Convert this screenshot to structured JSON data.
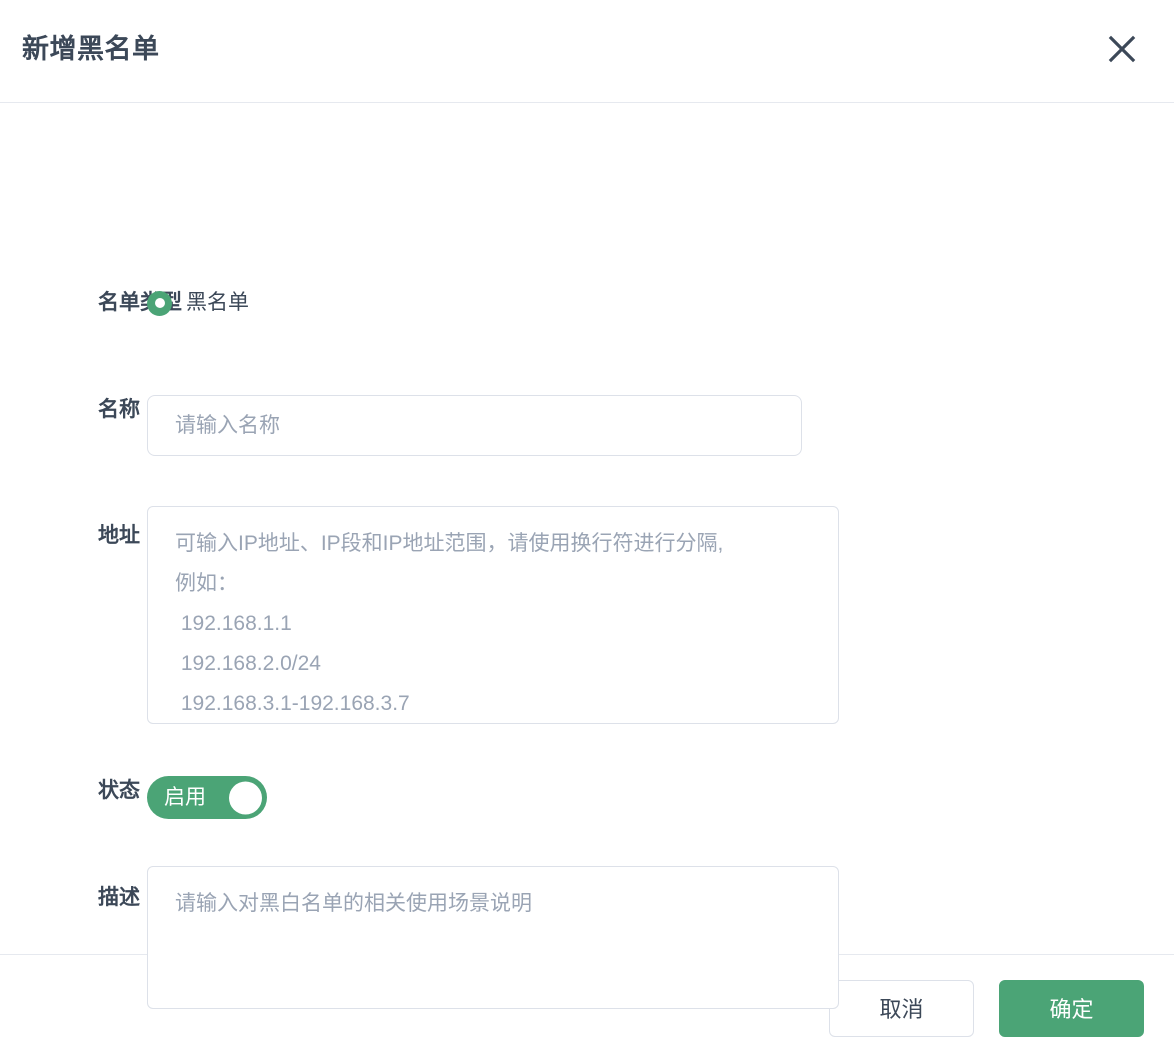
{
  "dialog": {
    "title": "新增黑名单",
    "close_icon": "close-icon"
  },
  "form": {
    "list_type": {
      "label": "名单类型",
      "selected": "黑名单",
      "options": [
        "黑名单"
      ]
    },
    "name": {
      "label": "名称",
      "value": "",
      "placeholder": "请输入名称"
    },
    "address": {
      "label": "地址",
      "value": "",
      "placeholder": "可输入IP地址、IP段和IP地址范围，请使用换行符进行分隔,\n例如：\n 192.168.1.1\n 192.168.2.0/24\n 192.168.3.1-192.168.3.7"
    },
    "status": {
      "label": "状态",
      "toggle_text": "启用",
      "enabled": true
    },
    "description": {
      "label": "描述",
      "value": "",
      "placeholder": "请输入对黑白名单的相关使用场景说明"
    }
  },
  "footer": {
    "cancel_label": "取消",
    "confirm_label": "确定"
  },
  "colors": {
    "accent_green": "#4ba476",
    "label_text": "#3c4858",
    "placeholder_text": "#9aa4b4",
    "border": "#dde1e9",
    "divider": "#e6e9ef"
  }
}
